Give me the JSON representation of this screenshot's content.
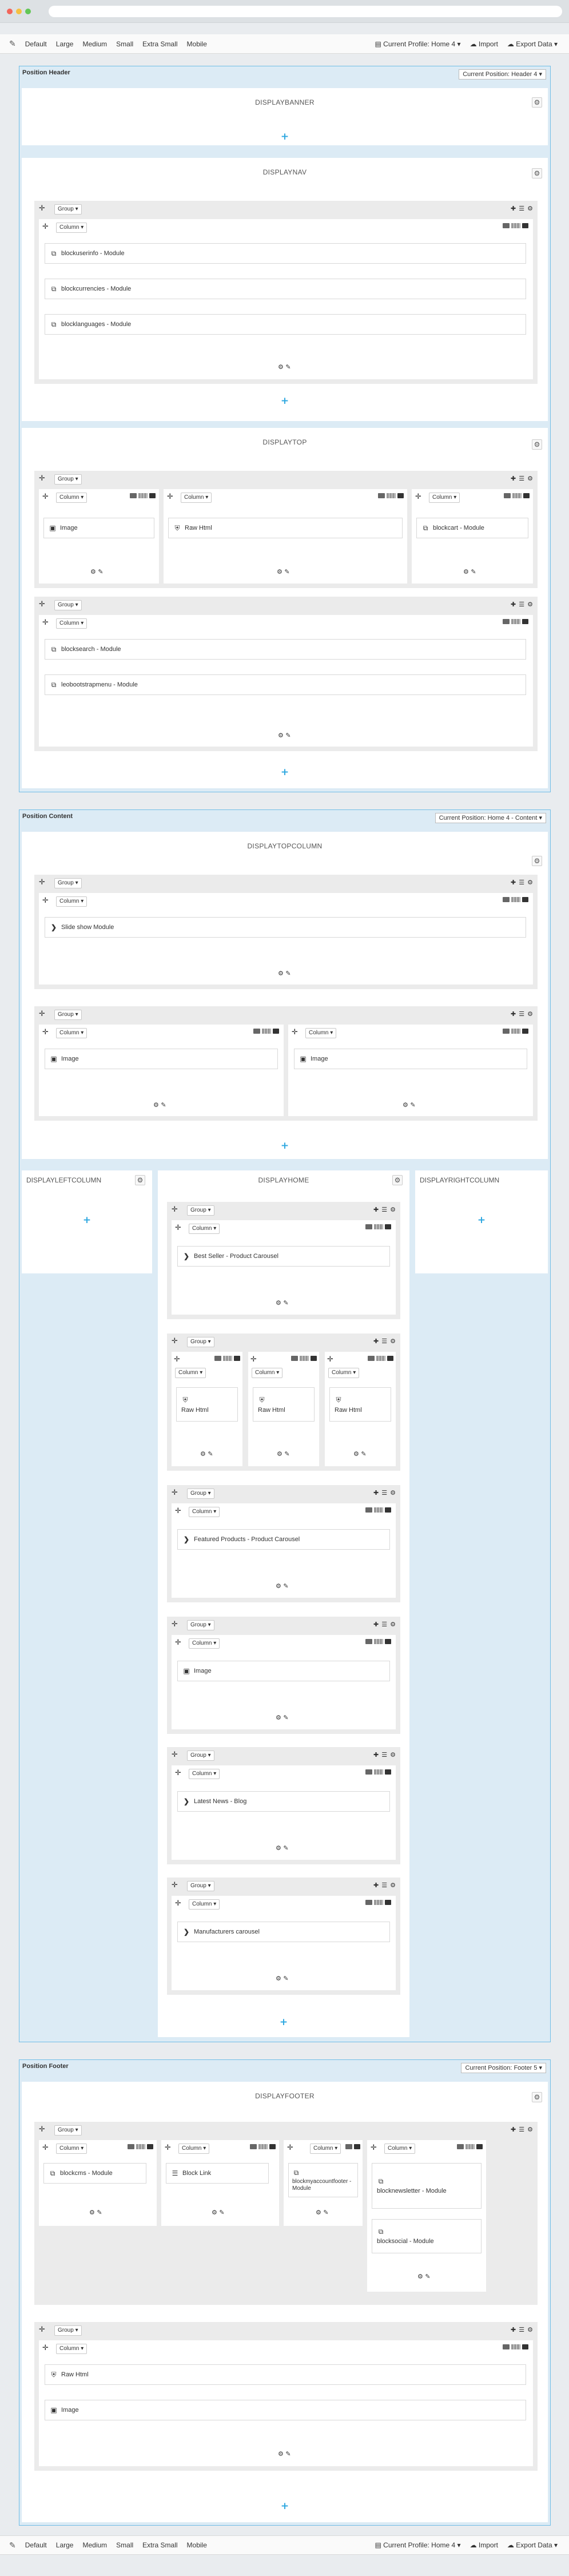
{
  "toolbar": {
    "devices": [
      "Default",
      "Large",
      "Medium",
      "Small",
      "Extra Small",
      "Mobile"
    ],
    "top_profile": "Current Profile: Home 4 ▾",
    "bottom_profile": "Current Profile: Home 4 ▾",
    "import_label": "Import",
    "export_label": "Export Data ▾"
  },
  "header": {
    "title": "Position Header",
    "badge": "Current Position: Header 4 ▾",
    "hooks": {
      "banner": "DISPLAYBANNER",
      "nav": "DISPLAYNAV",
      "top": "DISPLAYTOP"
    }
  },
  "content": {
    "title": "Position Content",
    "badge": "Current Position: Home 4 - Content ▾",
    "hooks": {
      "topcolumn": "DISPLAYTOPCOLUMN",
      "left": "DISPLAYLEFTCOLUMN",
      "home": "DISPLAYHOME",
      "right": "DISPLAYRIGHTCOLUMN"
    }
  },
  "footer": {
    "title": "Position Footer",
    "badge": "Current Position: Footer 5 ▾",
    "hooks": {
      "footer": "DISPLAYFOOTER"
    }
  },
  "labels": {
    "group": "Group ▾",
    "column": "Column ▾"
  },
  "modules": {
    "userinfo": "blockuserinfo - Module",
    "currencies": "blockcurrencies - Module",
    "languages": "blocklanguages - Module",
    "image": "Image",
    "raw_html": "Raw Html",
    "cart": "blockcart - Module",
    "search": "blocksearch - Module",
    "megamenu": "leobootstrapmenu - Module",
    "slideshow": "Slide show Module",
    "bestseller": "Best Seller - Product Carousel",
    "featured": "Featured Products - Product Carousel",
    "latest_news": "Latest News - Blog",
    "manufacturers": "Manufacturers carousel",
    "blockcms": "blockcms - Module",
    "block_link": "Block Link",
    "myaccount": "blockmyaccountfooter - Module",
    "newsletter": "blocknewsletter - Module",
    "social": "blocksocial - Module"
  },
  "colors": {
    "accent": "#2fa8e0",
    "section_bg": "#dcebf5",
    "section_border": "#71bde6",
    "group_bg": "#ebebeb"
  },
  "icons": [
    "edit-icon",
    "import-icon",
    "export-icon",
    "move-icon",
    "gear-icon",
    "plus-icon",
    "module-icon",
    "image-icon",
    "html-icon",
    "chevron-right-icon",
    "list-icon",
    "pencil-icon"
  ]
}
